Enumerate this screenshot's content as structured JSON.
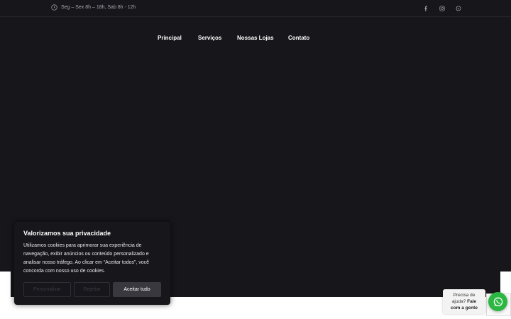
{
  "topbar": {
    "hours": "Seg – Sex 8h – 18h, Sab 8h - 12h",
    "social_icons": [
      "facebook-icon",
      "instagram-icon",
      "whatsapp-icon"
    ]
  },
  "nav": {
    "items": [
      {
        "label": "Principal"
      },
      {
        "label": "Serviços"
      },
      {
        "label": "Nossas Lojas"
      },
      {
        "label": "Contato"
      }
    ]
  },
  "cookie_banner": {
    "title": "Valorizamos sua privacidade",
    "text": "Utilizamos cookies para aprimorar sua experiência de navegação, exibir anúncios ou conteúdo personalizado e analisar nosso tráfego. Ao clicar em “Aceitar todos”, você concorda com nosso uso de cookies.",
    "customize_label": "Personalizar",
    "reject_label": "Rejeitar",
    "accept_label": "Aceitar tudo"
  },
  "help_bubble": {
    "line1": "Precisa de",
    "line2_prefix": "ajuda?",
    "line2_bold": "Fale",
    "line3": "com a gente"
  },
  "colors": {
    "background": "#16161b",
    "whatsapp_green": "#2bb741",
    "accept_button": "#38383e"
  }
}
